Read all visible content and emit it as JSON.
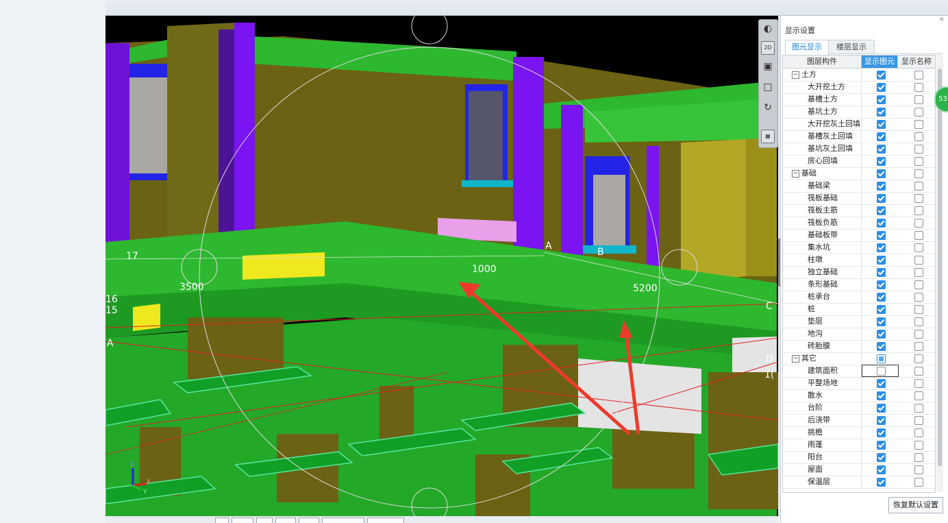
{
  "viewport": {
    "labels": [
      "17",
      "3500",
      "1000",
      "5200",
      "A",
      "B",
      "C",
      "D",
      "16",
      "15",
      "A",
      "1("
    ],
    "axis_labels": {
      "z": "Z",
      "x": "X",
      "y": "Y"
    }
  },
  "toolbar": {
    "icons": [
      "orbit-icon",
      "2d-view-icon",
      "3d-box-icon",
      "box-icon",
      "rotate-icon",
      "grid-icon"
    ],
    "label_2d": "2D"
  },
  "panel": {
    "title": "显示设置",
    "close": "×",
    "tabs": [
      "图元显示",
      "楼层显示"
    ],
    "active_tab": 0,
    "columns": [
      "图层构件",
      "显示图元",
      "显示名称"
    ],
    "rows": [
      {
        "type": "group",
        "name": "土方",
        "show": "on",
        "label": "off"
      },
      {
        "type": "child",
        "name": "大开挖土方",
        "show": "on",
        "label": "off"
      },
      {
        "type": "child",
        "name": "基槽土方",
        "show": "on",
        "label": "off"
      },
      {
        "type": "child",
        "name": "基坑土方",
        "show": "on",
        "label": "off"
      },
      {
        "type": "child",
        "name": "大开挖灰土回填",
        "show": "on",
        "label": "off"
      },
      {
        "type": "child",
        "name": "基槽灰土回填",
        "show": "on",
        "label": "off"
      },
      {
        "type": "child",
        "name": "基坑灰土回填",
        "show": "on",
        "label": "off"
      },
      {
        "type": "child",
        "name": "房心回填",
        "show": "on",
        "label": "off"
      },
      {
        "type": "group",
        "name": "基础",
        "show": "on",
        "label": "off"
      },
      {
        "type": "child",
        "name": "基础梁",
        "show": "on",
        "label": "off"
      },
      {
        "type": "child",
        "name": "筏板基础",
        "show": "on",
        "label": "off"
      },
      {
        "type": "child",
        "name": "筏板主筋",
        "show": "on",
        "label": "off"
      },
      {
        "type": "child",
        "name": "筏板负筋",
        "show": "on",
        "label": "off"
      },
      {
        "type": "child",
        "name": "基础板带",
        "show": "on",
        "label": "off"
      },
      {
        "type": "child",
        "name": "集水坑",
        "show": "on",
        "label": "off"
      },
      {
        "type": "child",
        "name": "柱墩",
        "show": "on",
        "label": "off"
      },
      {
        "type": "child",
        "name": "独立基础",
        "show": "on",
        "label": "off"
      },
      {
        "type": "child",
        "name": "条形基础",
        "show": "on",
        "label": "off"
      },
      {
        "type": "child",
        "name": "桩承台",
        "show": "on",
        "label": "off"
      },
      {
        "type": "child",
        "name": "桩",
        "show": "on",
        "label": "off"
      },
      {
        "type": "child",
        "name": "垫层",
        "show": "on",
        "label": "off"
      },
      {
        "type": "child",
        "name": "地沟",
        "show": "on",
        "label": "off"
      },
      {
        "type": "child",
        "name": "砖胎膜",
        "show": "on",
        "label": "off"
      },
      {
        "type": "group",
        "name": "其它",
        "show": "partial",
        "label": "off"
      },
      {
        "type": "child",
        "name": "建筑面积",
        "show": "off",
        "label": "off",
        "selected": true
      },
      {
        "type": "child",
        "name": "平整场地",
        "show": "on",
        "label": "off"
      },
      {
        "type": "child",
        "name": "散水",
        "show": "on",
        "label": "off"
      },
      {
        "type": "child",
        "name": "台阶",
        "show": "on",
        "label": "off"
      },
      {
        "type": "child",
        "name": "后浇带",
        "show": "on",
        "label": "off"
      },
      {
        "type": "child",
        "name": "挑檐",
        "show": "on",
        "label": "off"
      },
      {
        "type": "child",
        "name": "雨蓬",
        "show": "on",
        "label": "off"
      },
      {
        "type": "child",
        "name": "阳台",
        "show": "on",
        "label": "off"
      },
      {
        "type": "child",
        "name": "屋面",
        "show": "on",
        "label": "off"
      },
      {
        "type": "child",
        "name": "保温层",
        "show": "on",
        "label": "off"
      }
    ],
    "restore_button": "恢复默认设置"
  },
  "badge": {
    "text": "53"
  },
  "colors": {
    "green": "#2db82f",
    "olive": "#6b6214",
    "purple": "#7a14f0",
    "blue": "#2424e6",
    "yellow": "#f0e81e",
    "pink": "#e8a0e8",
    "arrow": "#ee3a2c",
    "accent": "#2d8ee6"
  }
}
